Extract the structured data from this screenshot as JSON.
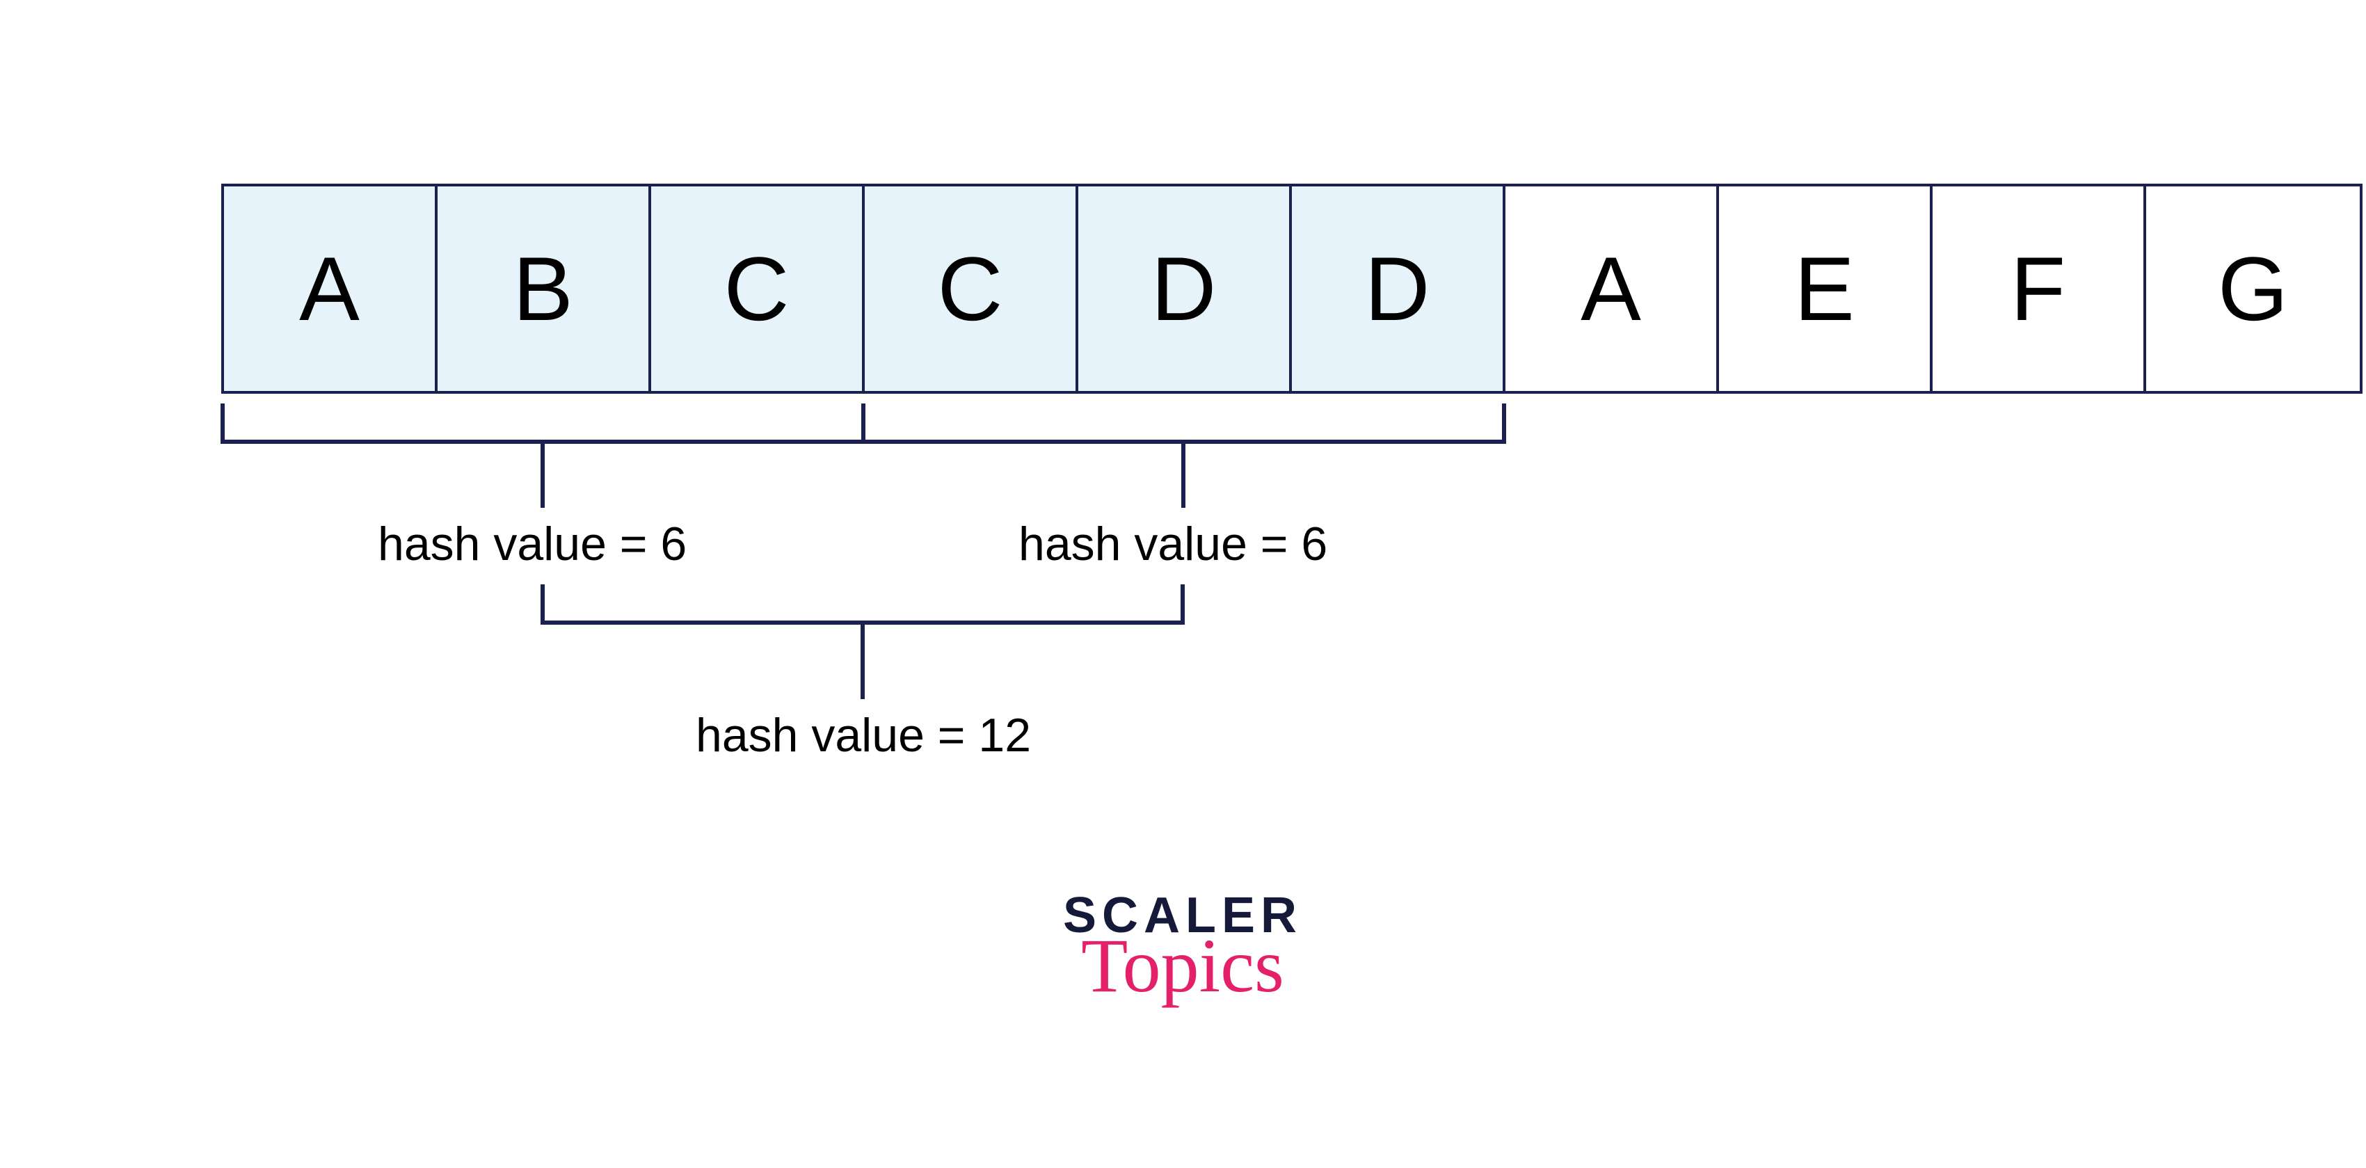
{
  "cells": [
    "A",
    "B",
    "C",
    "C",
    "D",
    "D",
    "A",
    "E",
    "F",
    "G"
  ],
  "hash_left": "hash value = 6",
  "hash_right": "hash value = 6",
  "hash_bottom": "hash value = 12",
  "logo_top": "SCALER",
  "logo_bottom": "Topics",
  "colors": {
    "cell_border": "#1a2050",
    "cell_light": "#e6f3fb",
    "brand_dark": "#151a3a",
    "brand_pink": "#e5206a"
  },
  "chart_data": {
    "type": "table",
    "title": "Sliding window hash values over character array",
    "array": [
      "A",
      "B",
      "C",
      "C",
      "D",
      "D",
      "A",
      "E",
      "F",
      "G"
    ],
    "windows": [
      {
        "start_index": 0,
        "end_index": 2,
        "chars": [
          "A",
          "B",
          "C"
        ],
        "hash_value": 6
      },
      {
        "start_index": 3,
        "end_index": 5,
        "chars": [
          "C",
          "D",
          "D"
        ],
        "hash_value": 6
      }
    ],
    "combined": {
      "start_index": 0,
      "end_index": 5,
      "chars": [
        "A",
        "B",
        "C",
        "C",
        "D",
        "D"
      ],
      "hash_value": 12
    }
  }
}
